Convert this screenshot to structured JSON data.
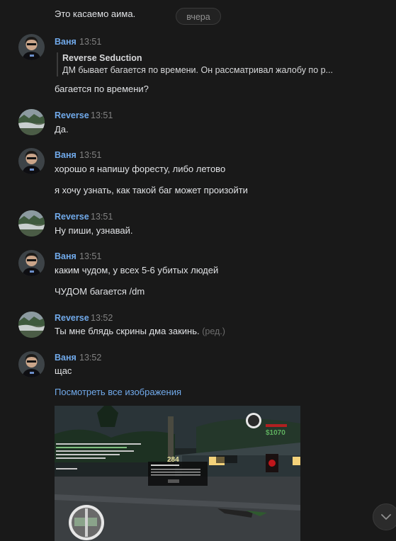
{
  "top": {
    "partial_text": "Это касаемо аима.",
    "date_separator": "вчера"
  },
  "messages": [
    {
      "author": "Ваня",
      "time": "13:51",
      "quote": {
        "author": "Reverse Seduction",
        "text": "ДМ бывает багается по времени. Он рассматривал жалобу по р..."
      },
      "lines": [
        "багается по времени?"
      ]
    },
    {
      "author": "Reverse",
      "time": "13:51",
      "lines": [
        "Да."
      ]
    },
    {
      "author": "Ваня",
      "time": "13:51",
      "lines": [
        "хорошо я напишу форесту, либо летово",
        "я хочу узнать, как такой баг может произойти"
      ]
    },
    {
      "author": "Reverse",
      "time": "13:51",
      "lines": [
        "Ну пиши, узнавай."
      ]
    },
    {
      "author": "Ваня",
      "time": "13:51",
      "lines": [
        "каким чудом, у всех 5-6 убитых людей",
        "ЧУДОМ багается /dm"
      ]
    },
    {
      "author": "Reverse",
      "time": "13:52",
      "lines": [
        "Ты мне блядь скрины дма закинь."
      ],
      "edited": "(ред.)"
    },
    {
      "author": "Ваня",
      "time": "13:52",
      "lines": [
        "щас"
      ]
    }
  ],
  "attachments": {
    "view_all_link": "Посмотреть все изображения",
    "game_money": "$1070",
    "game_counter": "284"
  },
  "colors": {
    "background": "#191919",
    "author_link": "#71aaeb",
    "text": "#e1e3e6",
    "muted": "#828282"
  },
  "icons": {
    "scroll_down": "chevron-down-icon",
    "avatar_vanya": "user-avatar",
    "avatar_reverse": "landscape-avatar"
  }
}
